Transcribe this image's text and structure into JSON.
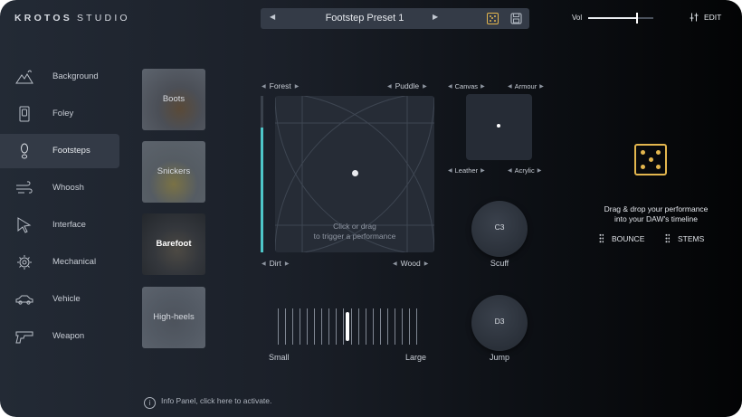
{
  "header": {
    "logo_brand": "KROTOS",
    "logo_product": "STUDIO",
    "preset_name": "Footstep Preset 1",
    "vol_label": "Vol",
    "volume_level": 0.75,
    "edit_label": "EDIT"
  },
  "sidebar": {
    "items": [
      {
        "label": "Background",
        "icon": "mountains-icon"
      },
      {
        "label": "Foley",
        "icon": "foley-icon"
      },
      {
        "label": "Footsteps",
        "icon": "footprint-icon",
        "active": true
      },
      {
        "label": "Whoosh",
        "icon": "whoosh-icon"
      },
      {
        "label": "Interface",
        "icon": "cursor-icon"
      },
      {
        "label": "Mechanical",
        "icon": "gear-icon"
      },
      {
        "label": "Vehicle",
        "icon": "car-icon"
      },
      {
        "label": "Weapon",
        "icon": "gun-icon"
      }
    ]
  },
  "sounds": [
    {
      "label": "Boots"
    },
    {
      "label": "Snickers"
    },
    {
      "label": "Barefoot",
      "active": true
    },
    {
      "label": "High-heels"
    }
  ],
  "xy_pad": {
    "top_left": "Forest",
    "top_right": "Puddle",
    "bottom_left": "Dirt",
    "bottom_right": "Wood",
    "hint_line1": "Click or drag",
    "hint_line2": "to trigger a performance",
    "level": 0.8
  },
  "mini_pad": {
    "top_left": "Canvas",
    "top_right": "Armour",
    "bottom_left": "Leather",
    "bottom_right": "Acrylic"
  },
  "knobs": [
    {
      "note": "C3",
      "label": "Scuff"
    },
    {
      "note": "D3",
      "label": "Jump"
    }
  ],
  "size_slider": {
    "min_label": "Small",
    "max_label": "Large",
    "value": 0.5
  },
  "right_panel": {
    "drag_line1": "Drag & drop your performance",
    "drag_line2": "into your DAW's timeline",
    "bounce_label": "BOUNCE",
    "stems_label": "STEMS"
  },
  "info_panel": {
    "icon_glyph": "i",
    "text": "Info Panel, click here to activate."
  },
  "colors": {
    "accent_gold": "#e3b64e",
    "level_teal": "#4ec6c9"
  }
}
